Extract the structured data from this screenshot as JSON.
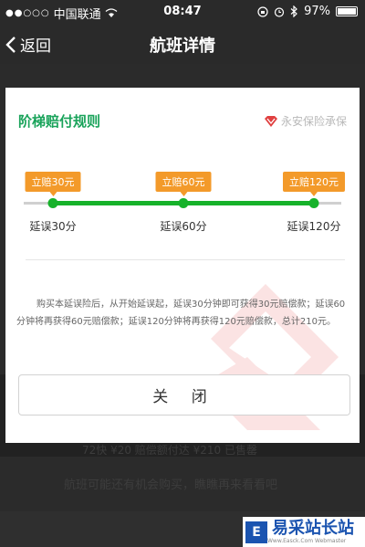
{
  "status_bar": {
    "carrier": "中国联通",
    "time": "08:47",
    "battery": "97%"
  },
  "nav": {
    "back_label": "返回",
    "title": "航班详情"
  },
  "modal": {
    "title": "阶梯赔付规则",
    "insurer": "永安保险承保",
    "tiers": [
      {
        "tag": "立赔30元",
        "label": "延误30分"
      },
      {
        "tag": "立赔60元",
        "label": "延误60分"
      },
      {
        "tag": "立赔120元",
        "label": "延误120分"
      }
    ],
    "rules_text": "购买本延误险后，从开始延误起，延误30分钟即可获得30元赔偿款；延误60分钟将再获得60元赔偿款；延误120分钟将再获得120元赔偿款，总计210元。",
    "close_label": "关 闭"
  },
  "background": {
    "row1": "72快 ¥20 赔偿额付达 ¥210 已售罄",
    "row2": "航班可能还有机会购买，瞧瞧再来看看吧"
  },
  "watermark_logo": {
    "text": "易采站长站",
    "sub": "Www.Easck.Com Webmaster",
    "mark": "E"
  },
  "colors": {
    "accent_green": "#19a35a",
    "progress_green": "#16b22a",
    "tag_orange": "#f39a2a",
    "insurer_red": "#e04040"
  }
}
